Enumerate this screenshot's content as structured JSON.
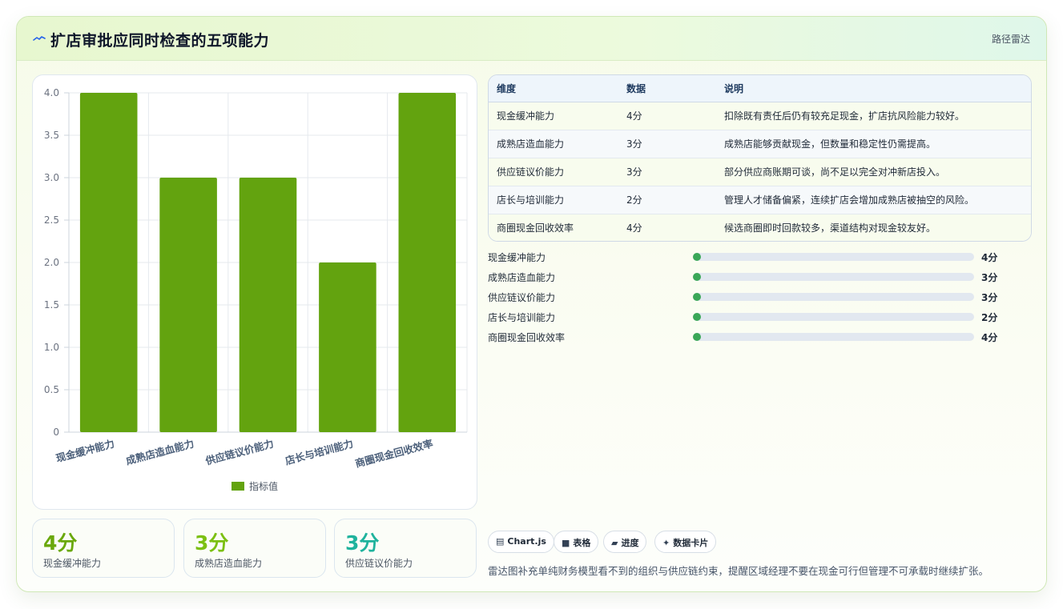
{
  "header": {
    "title": "扩店审批应同时检查的五项能力",
    "icon": "wave-icon",
    "tag": "路径雷达"
  },
  "chart_data": {
    "type": "bar",
    "categories": [
      "现金缓冲能力",
      "成熟店造血能力",
      "供应链议价能力",
      "店长与培训能力",
      "商圈现金回收效率"
    ],
    "series": [
      {
        "name": "指标值",
        "values": [
          4,
          3,
          3,
          2,
          4
        ],
        "color": "#63a30f"
      }
    ],
    "ylim": [
      0,
      4
    ],
    "yticks": [
      "0",
      "0.5",
      "1.0",
      "1.5",
      "2.0",
      "2.5",
      "3.0",
      "3.5",
      "4.0"
    ],
    "grid": true,
    "legend_position": "bottom"
  },
  "stats": [
    {
      "value": "4分",
      "label": "现金缓冲能力",
      "color": "#6aa80c"
    },
    {
      "value": "3分",
      "label": "成熟店造血能力",
      "color": "#7cc013"
    },
    {
      "value": "3分",
      "label": "供应链议价能力",
      "color": "#1fb39d"
    }
  ],
  "table": {
    "headers": [
      "维度",
      "数据",
      "说明"
    ],
    "rows": [
      {
        "dimension": "现金缓冲能力",
        "data": "4分",
        "note": "扣除既有责任后仍有较充足现金，扩店抗风险能力较好。"
      },
      {
        "dimension": "成熟店造血能力",
        "data": "3分",
        "note": "成熟店能够贡献现金，但数量和稳定性仍需提高。"
      },
      {
        "dimension": "供应链议价能力",
        "data": "3分",
        "note": "部分供应商账期可谈，尚不足以完全对冲新店投入。"
      },
      {
        "dimension": "店长与培训能力",
        "data": "2分",
        "note": "管理人才储备偏紧，连续扩店会增加成熟店被抽空的风险。"
      },
      {
        "dimension": "商圈现金回收效率",
        "data": "4分",
        "note": "候选商圈即时回款较多，渠道结构对现金较友好。"
      }
    ]
  },
  "progress": [
    {
      "name": "现金缓冲能力",
      "score": "4分",
      "fraction": 0.0
    },
    {
      "name": "成熟店造血能力",
      "score": "3分",
      "fraction": 0.0
    },
    {
      "name": "供应链议价能力",
      "score": "3分",
      "fraction": 0.0
    },
    {
      "name": "店长与培训能力",
      "score": "2分",
      "fraction": 0.0
    },
    {
      "name": "商圈现金回收效率",
      "score": "4分",
      "fraction": 0.0
    }
  ],
  "chips": [
    {
      "label": "Chart.js",
      "icon": "chart-icon",
      "glyph": "▤"
    },
    {
      "label": "表格",
      "icon": "table-icon",
      "glyph": "■"
    },
    {
      "label": "进度",
      "icon": "progress-icon",
      "glyph": "▰"
    },
    {
      "label": "数据卡片",
      "icon": "sparkle-icon",
      "glyph": "✦"
    }
  ],
  "footnote": "雷达图补充单纯财务模型看不到的组织与供应链约束，提醒区域经理不要在现金可行但管理不可承载时继续扩张。"
}
